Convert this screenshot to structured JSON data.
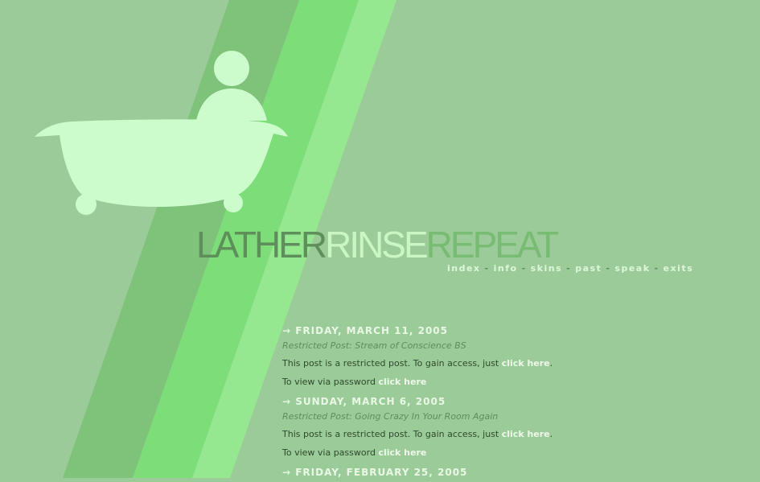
{
  "colors": {
    "background": "#9bcb98",
    "stripe_dark": "#7fc27a",
    "stripe_mid": "#7ddd79",
    "stripe_light": "#95e890",
    "tub": "#cdfccc",
    "logo_lather": "#5e8f5b",
    "logo_rinse": "#c9f6c2",
    "logo_repeat": "#78bb72",
    "accent_text": "#e8f8e4"
  },
  "illustration": {
    "icon": "bathtub-person-icon"
  },
  "logo": {
    "lather": "LATHER",
    "rinse": "RINSE",
    "repeat": "REPEAT"
  },
  "nav": {
    "items": [
      "index",
      "info",
      "skins",
      "past",
      "speak",
      "exits"
    ],
    "separator": "-"
  },
  "posts": [
    {
      "date": "→ FRIDAY, MARCH 11, 2005",
      "title": "Restricted Post: Stream of Conscience BS",
      "body_prefix": "This post is a restricted post. To gain access, just ",
      "body_link": "click here",
      "body_suffix": ".",
      "password_prefix": "To view via password ",
      "password_link": "click here"
    },
    {
      "date": "→ SUNDAY, MARCH 6, 2005",
      "title": "Restricted Post: Going Crazy In Your Room Again",
      "body_prefix": "This post is a restricted post. To gain access, just ",
      "body_link": "click here",
      "body_suffix": ".",
      "password_prefix": "To view via password ",
      "password_link": "click here"
    },
    {
      "date": "→ FRIDAY, FEBRUARY 25, 2005"
    }
  ]
}
